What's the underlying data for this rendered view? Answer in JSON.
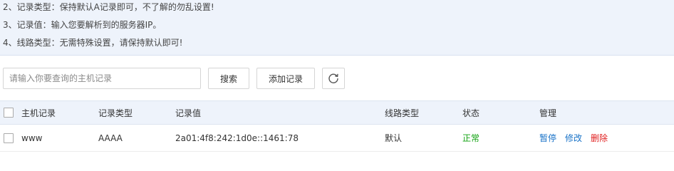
{
  "tips": [
    "2、记录类型：保持默认A记录即可，不了解的勿乱设置!",
    "3、记录值：输入您要解析到的服务器IP。",
    "4、线路类型：无需特殊设置，请保持默认即可!"
  ],
  "toolbar": {
    "search_placeholder": "请输入你要查询的主机记录",
    "search_label": "搜索",
    "add_label": "添加记录"
  },
  "table": {
    "headers": {
      "host": "主机记录",
      "type": "记录类型",
      "value": "记录值",
      "line": "线路类型",
      "status": "状态",
      "manage": "管理"
    },
    "rows": [
      {
        "host": "www",
        "type": "AAAA",
        "value": "2a01:4f8:242:1d0e::1461:78",
        "line": "默认",
        "status": "正常",
        "actions": {
          "pause": "暂停",
          "edit": "修改",
          "delete": "删除"
        }
      }
    ]
  },
  "colors": {
    "panel_bg": "#eef3fb",
    "link_blue": "#1a73c8",
    "delete_red": "#e02020",
    "status_green": "#12a312"
  }
}
